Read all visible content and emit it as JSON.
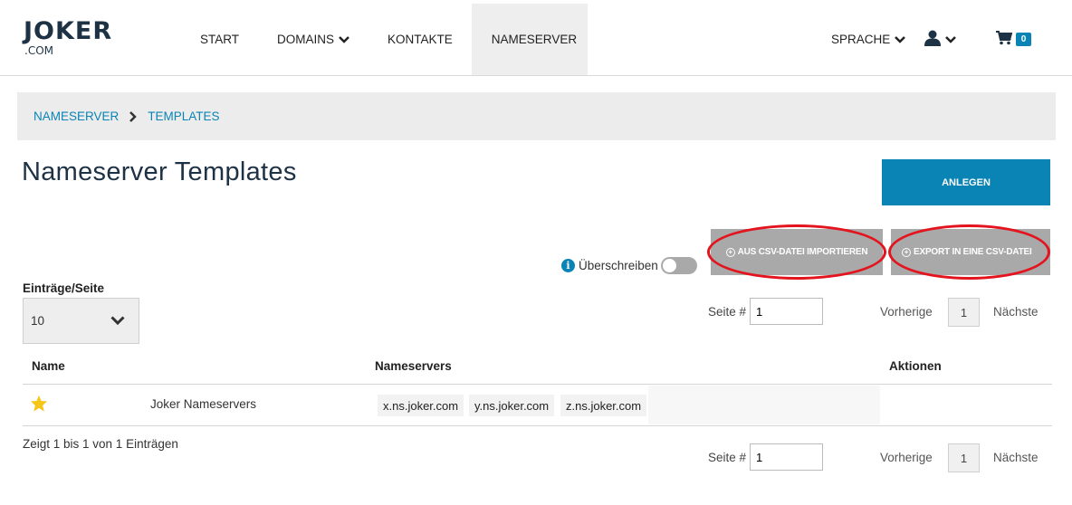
{
  "header": {
    "logo_main": "JOKER",
    "logo_sub": ".COM",
    "nav": [
      "START",
      "DOMAINS",
      "KONTAKTE",
      "NAMESERVER"
    ],
    "sprache": "SPRACHE",
    "cart_count": "0"
  },
  "breadcrumb": {
    "level1": "NAMESERVER",
    "level2": "TEMPLATES"
  },
  "page": {
    "title": "Nameserver Templates",
    "btn_create": "ANLEGEN",
    "btn_import": "AUS CSV-DATEI IMPORTIEREN",
    "btn_export": "EXPORT IN EINE CSV-DATEI",
    "overwrite_label": "Überschreiben",
    "overwrite_on": false,
    "entries_label": "Einträge/Seite",
    "entries_value": "10"
  },
  "pagination": {
    "page_label": "Seite #",
    "page_value": "1",
    "prev": "Vorherige",
    "next": "Nächste",
    "current": "1"
  },
  "table": {
    "headers": {
      "name": "Name",
      "nameservers": "Nameservers",
      "actions": "Aktionen"
    },
    "rows": [
      {
        "default": true,
        "name": "Joker Nameservers",
        "nameservers": [
          "x.ns.joker.com",
          "y.ns.joker.com",
          "z.ns.joker.com"
        ]
      }
    ],
    "summary": "Zeigt 1 bis 1 von 1 Einträgen"
  },
  "colors": {
    "accent": "#0a84b5",
    "highlight": "#e3141e",
    "star": "#f5c518"
  }
}
